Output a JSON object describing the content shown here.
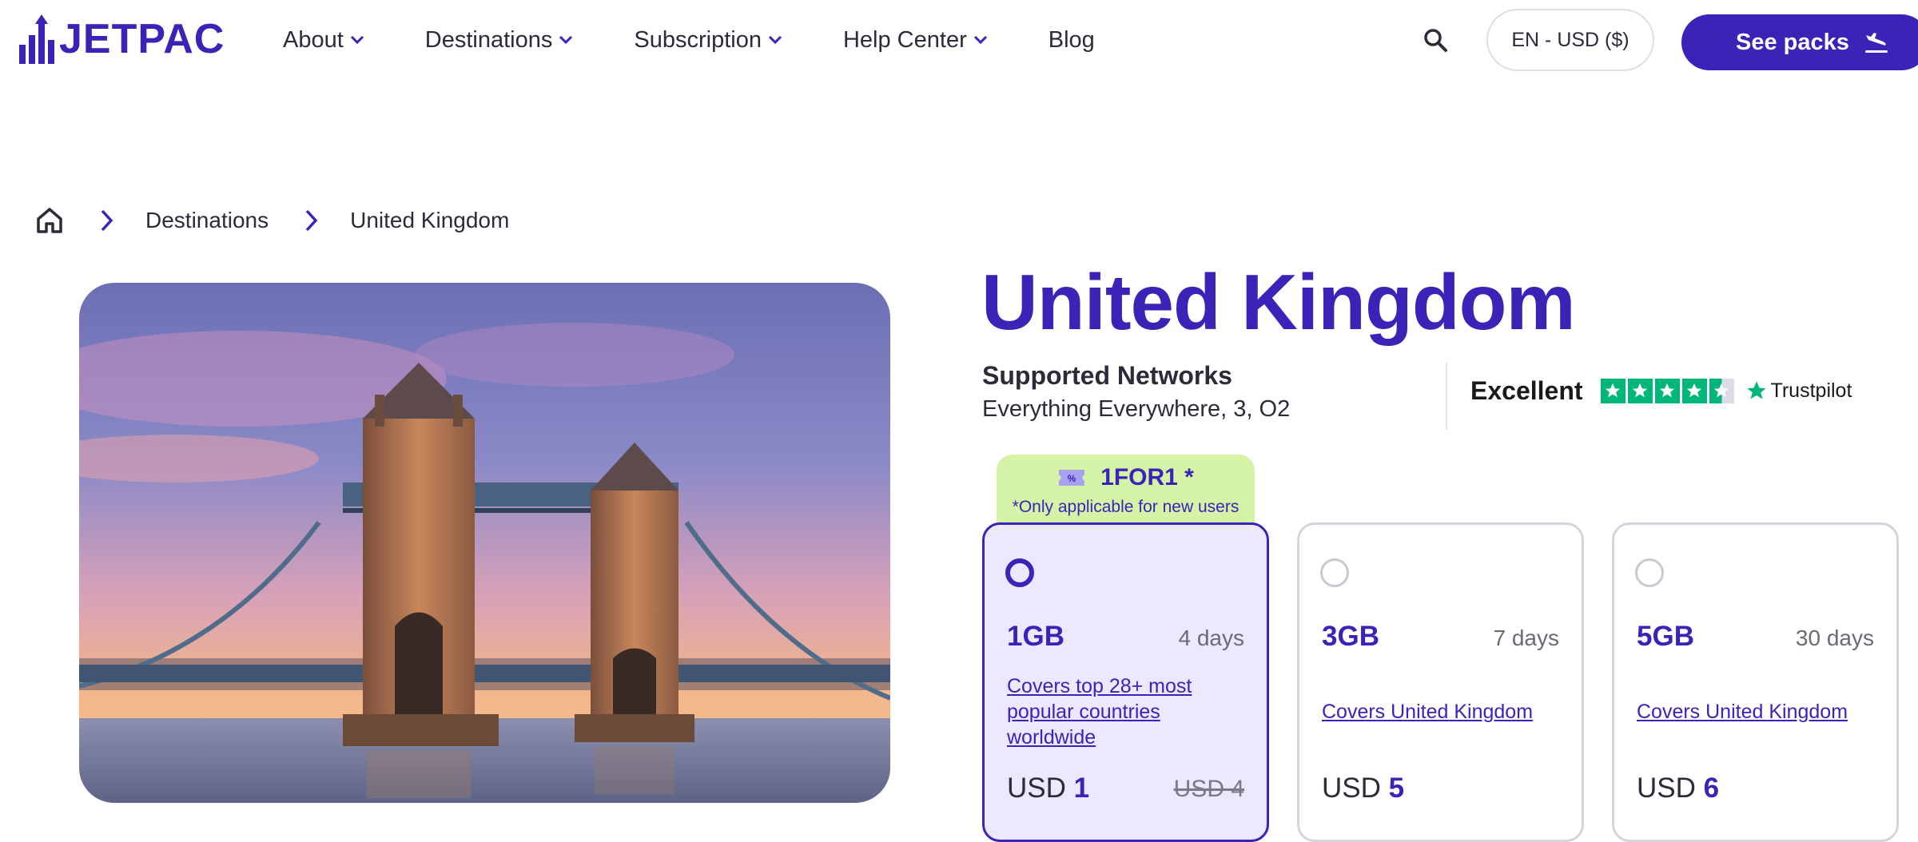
{
  "brand": {
    "name": "JETPAC",
    "color": "#3a24b8"
  },
  "nav": {
    "items": [
      {
        "label": "About",
        "has_dropdown": true
      },
      {
        "label": "Destinations",
        "has_dropdown": true
      },
      {
        "label": "Subscription",
        "has_dropdown": true
      },
      {
        "label": "Help Center",
        "has_dropdown": true
      },
      {
        "label": "Blog",
        "has_dropdown": false
      }
    ],
    "search_icon": "search-icon",
    "language_currency": "EN - USD ($)",
    "cta_label": "See packs",
    "cta_icon": "plane-landing-icon"
  },
  "breadcrumb": {
    "home_icon": "home-icon",
    "separator_icon": "chevron-right-icon",
    "items": [
      "Destinations",
      "United Kingdom"
    ]
  },
  "hero": {
    "image_subject": "Tower Bridge at sunset"
  },
  "destination": {
    "title": "United Kingdom",
    "networks_label": "Supported Networks",
    "networks_value": "Everything Everywhere, 3, O2"
  },
  "trustpilot": {
    "rating_word": "Excellent",
    "stars": 4.5,
    "brand": "Trustpilot",
    "star_color": "#00b67a"
  },
  "promo": {
    "icon": "ticket-icon",
    "code": "1FOR1 *",
    "note": "*Only applicable for new users",
    "bg_color": "#d4f3a6"
  },
  "plans": [
    {
      "size": "1GB",
      "duration": "4 days",
      "coverage": "Covers top 28+ most popular countries worldwide",
      "currency": "USD",
      "price": "1",
      "old_price": "USD 4",
      "selected": true
    },
    {
      "size": "3GB",
      "duration": "7 days",
      "coverage": "Covers United Kingdom",
      "currency": "USD",
      "price": "5",
      "old_price": "",
      "selected": false
    },
    {
      "size": "5GB",
      "duration": "30 days",
      "coverage": "Covers United Kingdom",
      "currency": "USD",
      "price": "6",
      "old_price": "",
      "selected": false
    }
  ]
}
